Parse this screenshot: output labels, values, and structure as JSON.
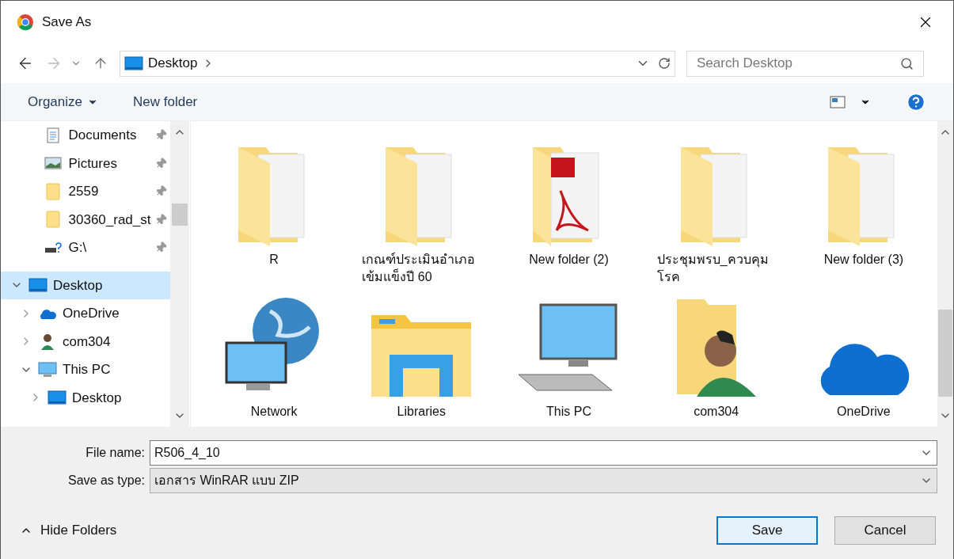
{
  "window": {
    "title": "Save As"
  },
  "address_bar": {
    "location": "Desktop",
    "search_placeholder": "Search Desktop"
  },
  "toolbar": {
    "organize": "Organize",
    "new_folder": "New folder"
  },
  "sidebar": {
    "pinned": [
      {
        "label": "Documents",
        "kind": "documents",
        "pinned": true
      },
      {
        "label": "Pictures",
        "kind": "pictures",
        "pinned": true
      },
      {
        "label": "2559",
        "kind": "folder",
        "pinned": true
      },
      {
        "label": "30360_rad_st",
        "kind": "folder",
        "pinned": true
      },
      {
        "label": "G:\\",
        "kind": "drive",
        "pinned": true
      }
    ],
    "tree": [
      {
        "label": "Desktop",
        "kind": "desktop",
        "expanded": true,
        "selected": true,
        "children": [
          {
            "label": "OneDrive",
            "kind": "cloud",
            "expanded": false,
            "selected": false
          },
          {
            "label": "com304",
            "kind": "user",
            "expanded": false,
            "selected": false
          },
          {
            "label": "This PC",
            "kind": "computer",
            "expanded": true,
            "selected": false,
            "children": [
              {
                "label": "Desktop",
                "kind": "desktop",
                "expanded": false,
                "selected": false
              }
            ]
          }
        ]
      }
    ]
  },
  "items": [
    {
      "label": "R",
      "kind": "folder"
    },
    {
      "label": "เกณฑ์ประเมินอำเภอเข้มแข็งปี 60",
      "kind": "folder"
    },
    {
      "label": "New folder (2)",
      "kind": "pdf-folder"
    },
    {
      "label": "ประชุมพรบ_ควบคุมโรค",
      "kind": "folder"
    },
    {
      "label": "New folder (3)",
      "kind": "folder"
    },
    {
      "label": "Network",
      "kind": "network"
    },
    {
      "label": "Libraries",
      "kind": "libraries"
    },
    {
      "label": "This PC",
      "kind": "computer"
    },
    {
      "label": "com304",
      "kind": "user"
    },
    {
      "label": "OneDrive",
      "kind": "cloud"
    }
  ],
  "form": {
    "file_name_label": "File name:",
    "file_name": "R506_4_10",
    "type_label": "Save as type:",
    "type": "เอกสาร WinRAR แบบ ZIP"
  },
  "footer": {
    "hide_folders": "Hide Folders",
    "save": "Save",
    "cancel": "Cancel"
  }
}
